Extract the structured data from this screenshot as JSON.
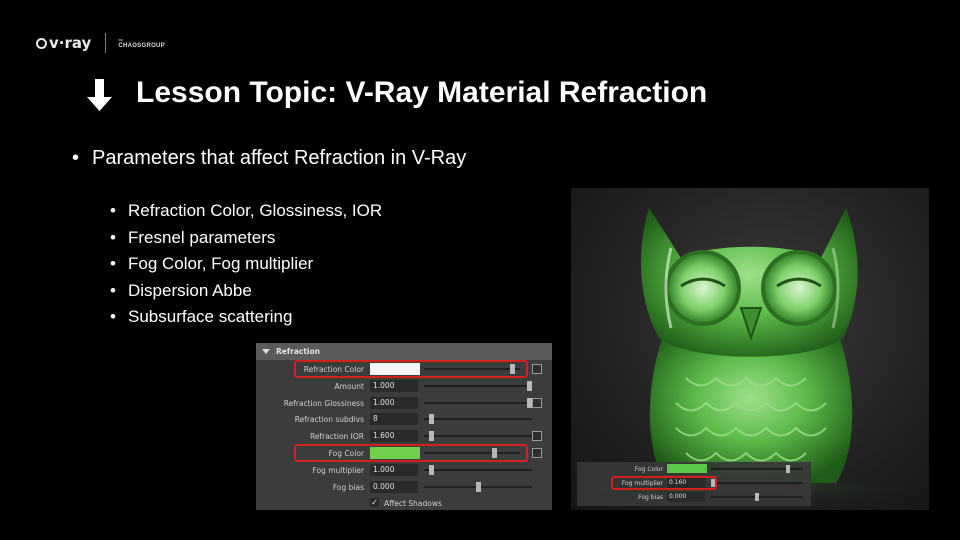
{
  "logo": {
    "brand": "v·ray",
    "partner_top": "by",
    "partner": "CHAOSGROUP"
  },
  "title": {
    "text": "Lesson Topic: V-Ray Material Refraction",
    "icon": "down-arrow-icon"
  },
  "main_bullet": "Parameters that affect Refraction in V-Ray",
  "sub_bullets": [
    "Refraction Color, Glossiness, IOR",
    "Fresnel parameters",
    "Fog Color, Fog multiplier",
    "Dispersion Abbe",
    "Subsurface scattering"
  ],
  "panel": {
    "header": "Refraction",
    "rows": [
      {
        "label": "Refraction Color",
        "swatch": "#f4f4f4",
        "slider": 0.95,
        "highlight": true
      },
      {
        "label": "Amount",
        "value": "1.000",
        "slider": 1.0
      },
      {
        "label": "Refraction Glossiness",
        "value": "1.000",
        "slider": 1.0
      },
      {
        "label": "Refraction subdivs",
        "value": "8",
        "slider": 0.05
      },
      {
        "label": "Refraction IOR",
        "value": "1.600",
        "slider": 0.05
      },
      {
        "label": "Fog Color",
        "swatch": "#6fcf4f",
        "slider": 0.75,
        "highlight": true
      },
      {
        "label": "Fog multiplier",
        "value": "1.000",
        "slider": 0.05
      },
      {
        "label": "Fog bias",
        "value": "0.000",
        "slider": 0.5
      }
    ],
    "checkbox": {
      "label": "Affect Shadows",
      "checked": true
    }
  },
  "render_panel": {
    "rows": [
      {
        "label": "Fog Color",
        "swatch": "#5cc84a",
        "slider": 0.85
      },
      {
        "label": "Fog multiplier",
        "value": "0.160",
        "slider": 0.0,
        "highlight": true
      },
      {
        "label": "Fog bias",
        "value": "0.000",
        "slider": 0.5
      }
    ]
  },
  "colors": {
    "background": "#000000",
    "highlight": "#d21f1f",
    "glass_green": "#4caf3c"
  }
}
